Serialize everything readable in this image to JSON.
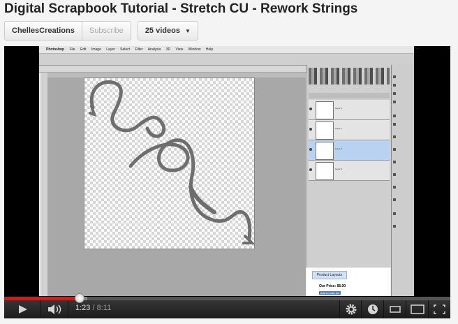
{
  "page": {
    "title": "Digital Scrapbook Tutorial - Stretch CU - Rework Strings"
  },
  "channel": {
    "name": "ChellesCreations",
    "subscribe_label": "Subscribe",
    "videos_label": "25 videos"
  },
  "screen": {
    "menu": [
      "Photoshop",
      "File",
      "Edit",
      "Image",
      "Layer",
      "Select",
      "Filter",
      "Analysis",
      "3D",
      "View",
      "Window",
      "Help"
    ],
    "layers": [
      "Layer 2",
      "Layer 1",
      "Layer 3",
      "Layer 0"
    ],
    "selected_layer": "Layer 3",
    "web": {
      "product_layouts": "Product Layouts",
      "price": "Our Price: $6.00",
      "wish": "Add to wish list"
    }
  },
  "player": {
    "current_time": "1:23",
    "separator": " / ",
    "duration": "8:11",
    "progress": 0.169,
    "loaded": 0.187
  },
  "colors": {
    "played": "#d21b1b",
    "rope": "#6e6e6e"
  },
  "icons": [
    "play-icon",
    "volume-icon",
    "gear-icon",
    "clock-icon",
    "small-player-icon",
    "large-player-icon",
    "fullscreen-icon"
  ]
}
